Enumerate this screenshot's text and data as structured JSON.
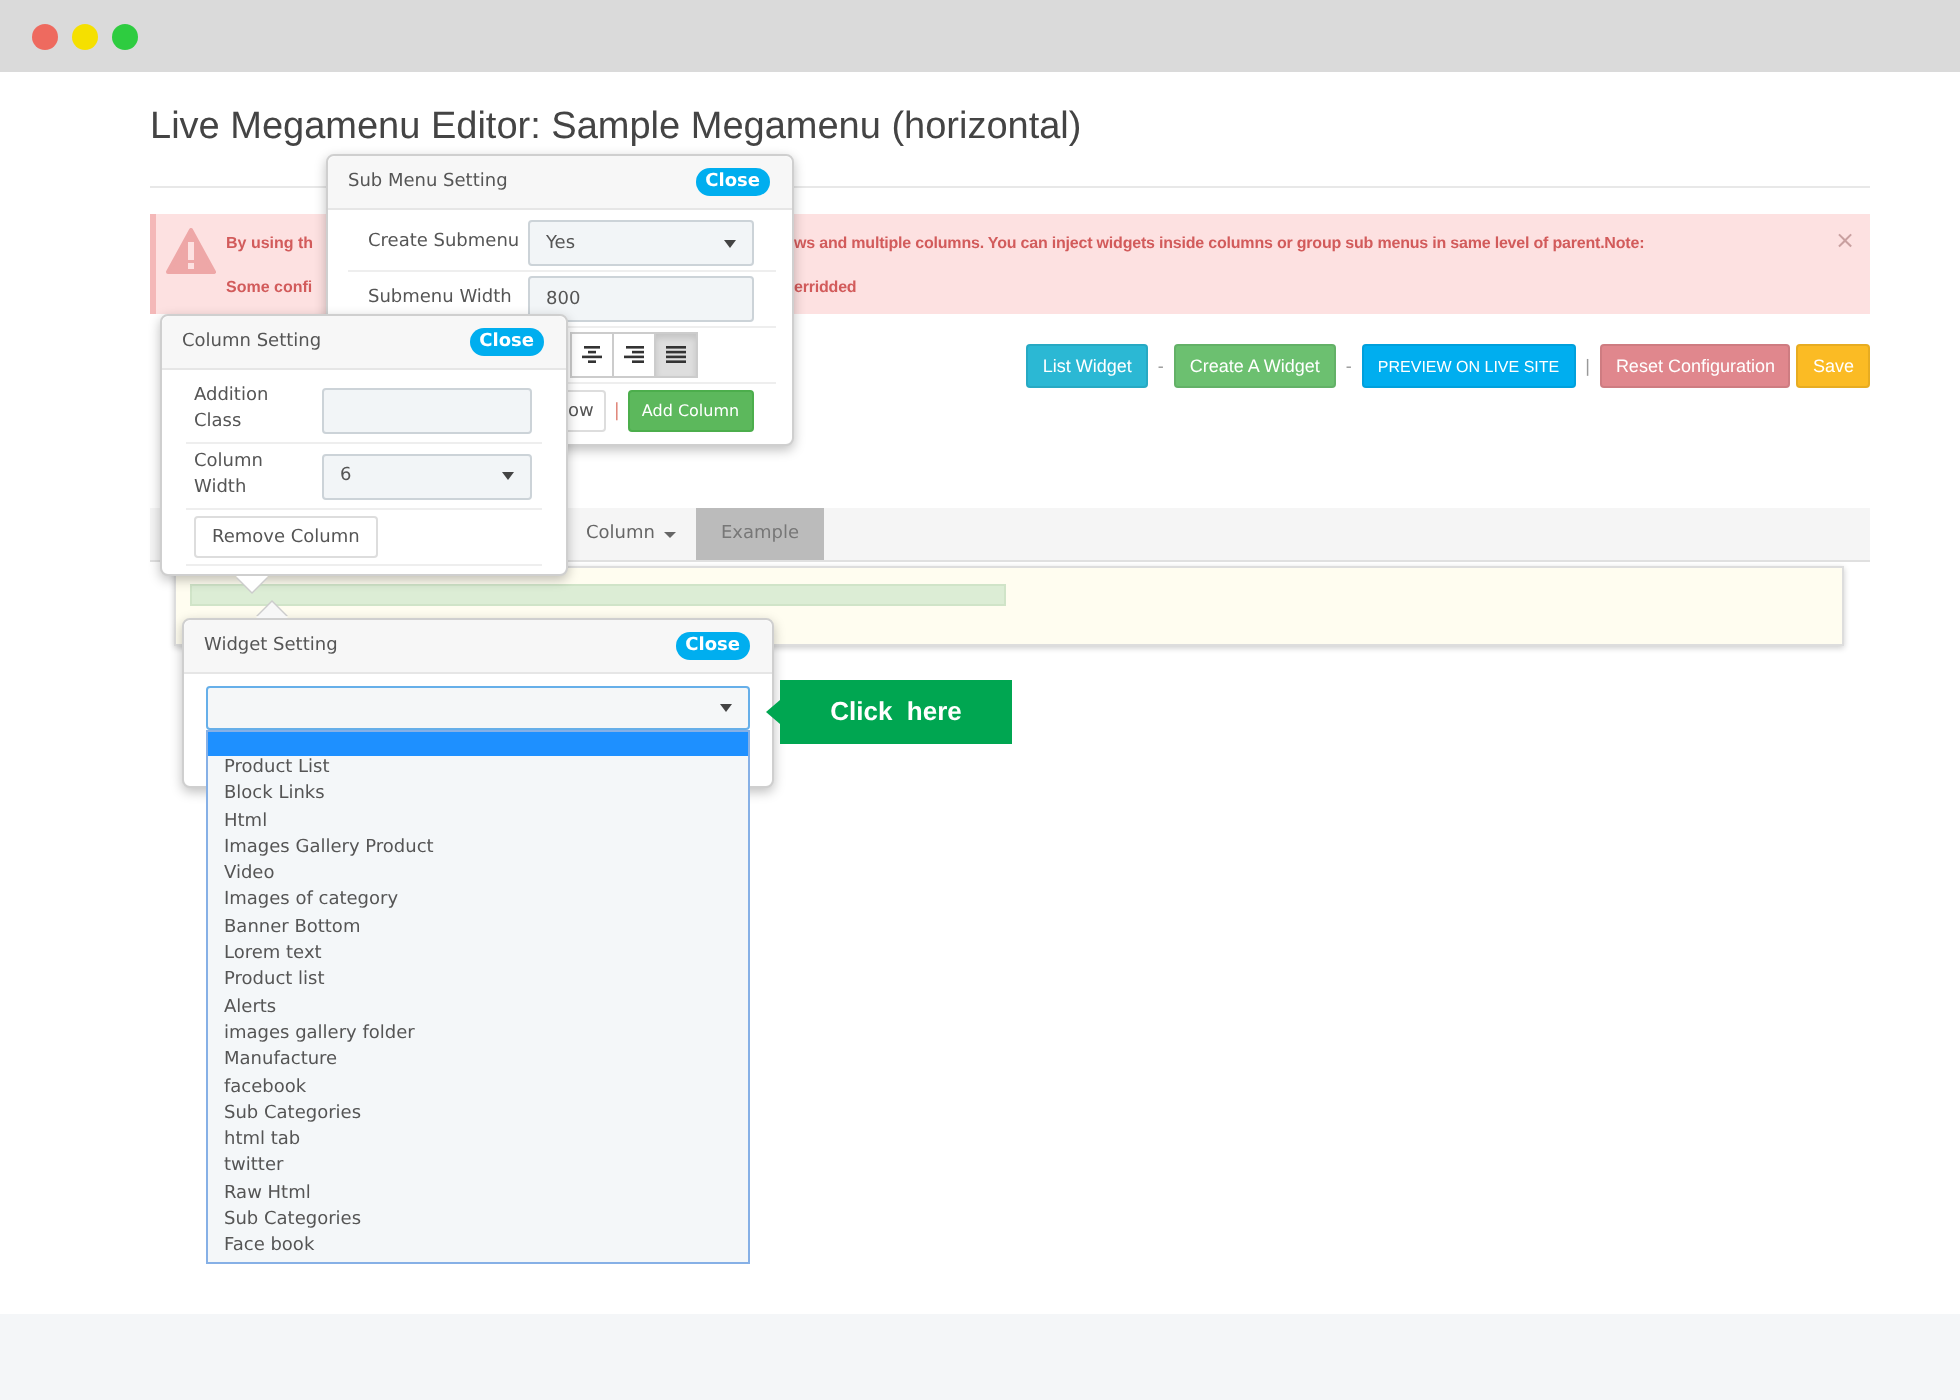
{
  "page": {
    "title": "Live Megamenu Editor: Sample Megamenu (horizontal)"
  },
  "alert": {
    "lines": [
      {
        "left": "By using th",
        "right": "ws and multiple columns. You can inject widgets inside columns or group sub menus in same level of parent.Note:"
      },
      {
        "left": "Some confi",
        "right": "erridded"
      }
    ],
    "close": "×"
  },
  "toolbar": {
    "items": [
      {
        "kind": "info",
        "label": "List Widget"
      },
      {
        "kind": "separator",
        "label": "-"
      },
      {
        "kind": "success",
        "label": "Create A Widget"
      },
      {
        "kind": "separator",
        "label": "-"
      },
      {
        "kind": "primary",
        "label": "PREVIEW ON LIVE SITE"
      },
      {
        "kind": "separator",
        "label": "|"
      },
      {
        "kind": "danger",
        "label": "Reset Configuration"
      },
      {
        "kind": "warning",
        "label": "Save"
      }
    ]
  },
  "tabs": [
    {
      "label": "Column",
      "selected": false,
      "caret": true
    },
    {
      "label": "Example",
      "selected": true,
      "caret": false
    }
  ],
  "sub_menu_setting": {
    "title": "Sub Menu Setting",
    "close": "Close",
    "create_submenu": {
      "label": "Create Submenu",
      "value": "Yes"
    },
    "submenu_width": {
      "label": "Submenu Width",
      "value": "800"
    },
    "alignment_buttons": [
      {
        "kind": "center",
        "selected": false
      },
      {
        "kind": "right",
        "selected": false
      },
      {
        "kind": "justify",
        "selected": true
      }
    ],
    "row_button": "ow",
    "separator": "|",
    "add_column": "Add Column"
  },
  "column_setting": {
    "title": "Column Setting",
    "close": "Close",
    "addition_class": {
      "label": "Addition Class"
    },
    "column_width": {
      "label": "Column Width",
      "value": "6"
    },
    "remove_column": "Remove Column"
  },
  "widget_setting": {
    "title": "Widget Setting",
    "close": "Close",
    "blank_option_highlighted": true,
    "options": [
      "Product List",
      "Block Links",
      "Html",
      "Images Gallery Product",
      "Video",
      "Images of category",
      "Banner Bottom",
      "Lorem text",
      "Product list",
      "Alerts",
      "images gallery folder",
      "Manufacture",
      "facebook",
      "Sub Categories",
      "html tab",
      "twitter",
      "Raw Html",
      "Sub Categories",
      "Face book"
    ]
  },
  "callout": {
    "text": "Click  here"
  }
}
